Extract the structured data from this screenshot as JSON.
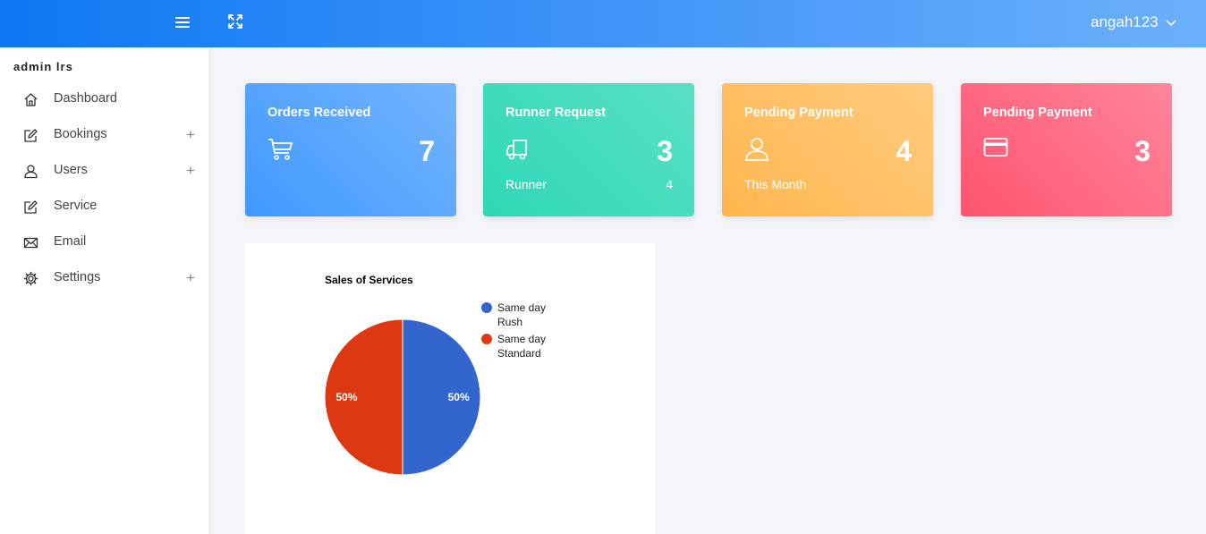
{
  "header": {
    "menu_icon": "hamburger-icon",
    "fullscreen_icon": "expand-icon",
    "username": "angah123",
    "user_menu_icon": "chevron-down-icon"
  },
  "sidebar": {
    "brand": "admin lrs",
    "items": [
      {
        "label": "Dashboard",
        "icon": "home-icon",
        "expandable": false
      },
      {
        "label": "Bookings",
        "icon": "edit-icon",
        "expandable": true
      },
      {
        "label": "Users",
        "icon": "user-icon",
        "expandable": true
      },
      {
        "label": "Service",
        "icon": "edit-icon",
        "expandable": false
      },
      {
        "label": "Email",
        "icon": "mail-icon",
        "expandable": false
      },
      {
        "label": "Settings",
        "icon": "gear-icon",
        "expandable": true
      }
    ],
    "expand_symbol": "+"
  },
  "cards": [
    {
      "title": "Orders Received",
      "value": "7",
      "icon": "cart-icon",
      "sub_label": "",
      "sub_value": "",
      "color": "#4099ff"
    },
    {
      "title": "Runner Request",
      "value": "3",
      "icon": "truck-icon",
      "sub_label": "Runner",
      "sub_value": "4",
      "color": "#2ed8b6"
    },
    {
      "title": "Pending Payment",
      "value": "4",
      "icon": "user-icon",
      "sub_label": "This Month",
      "sub_value": "",
      "color": "#ffb64d"
    },
    {
      "title": "Pending Payment",
      "value": "3",
      "icon": "credit-card-icon",
      "sub_label": "",
      "sub_value": "",
      "color": "#ff5370"
    }
  ],
  "chart_data": {
    "type": "pie",
    "title": "Sales of Services",
    "categories": [
      "Same day Rush",
      "Same day Standard"
    ],
    "values": [
      50,
      50
    ],
    "labels": [
      "50%",
      "50%"
    ],
    "colors": [
      "#3366cc",
      "#dc3912"
    ],
    "legend_position": "right",
    "legend_lines": [
      [
        "Same day",
        "Rush"
      ],
      [
        "Same day",
        "Standard"
      ]
    ]
  }
}
